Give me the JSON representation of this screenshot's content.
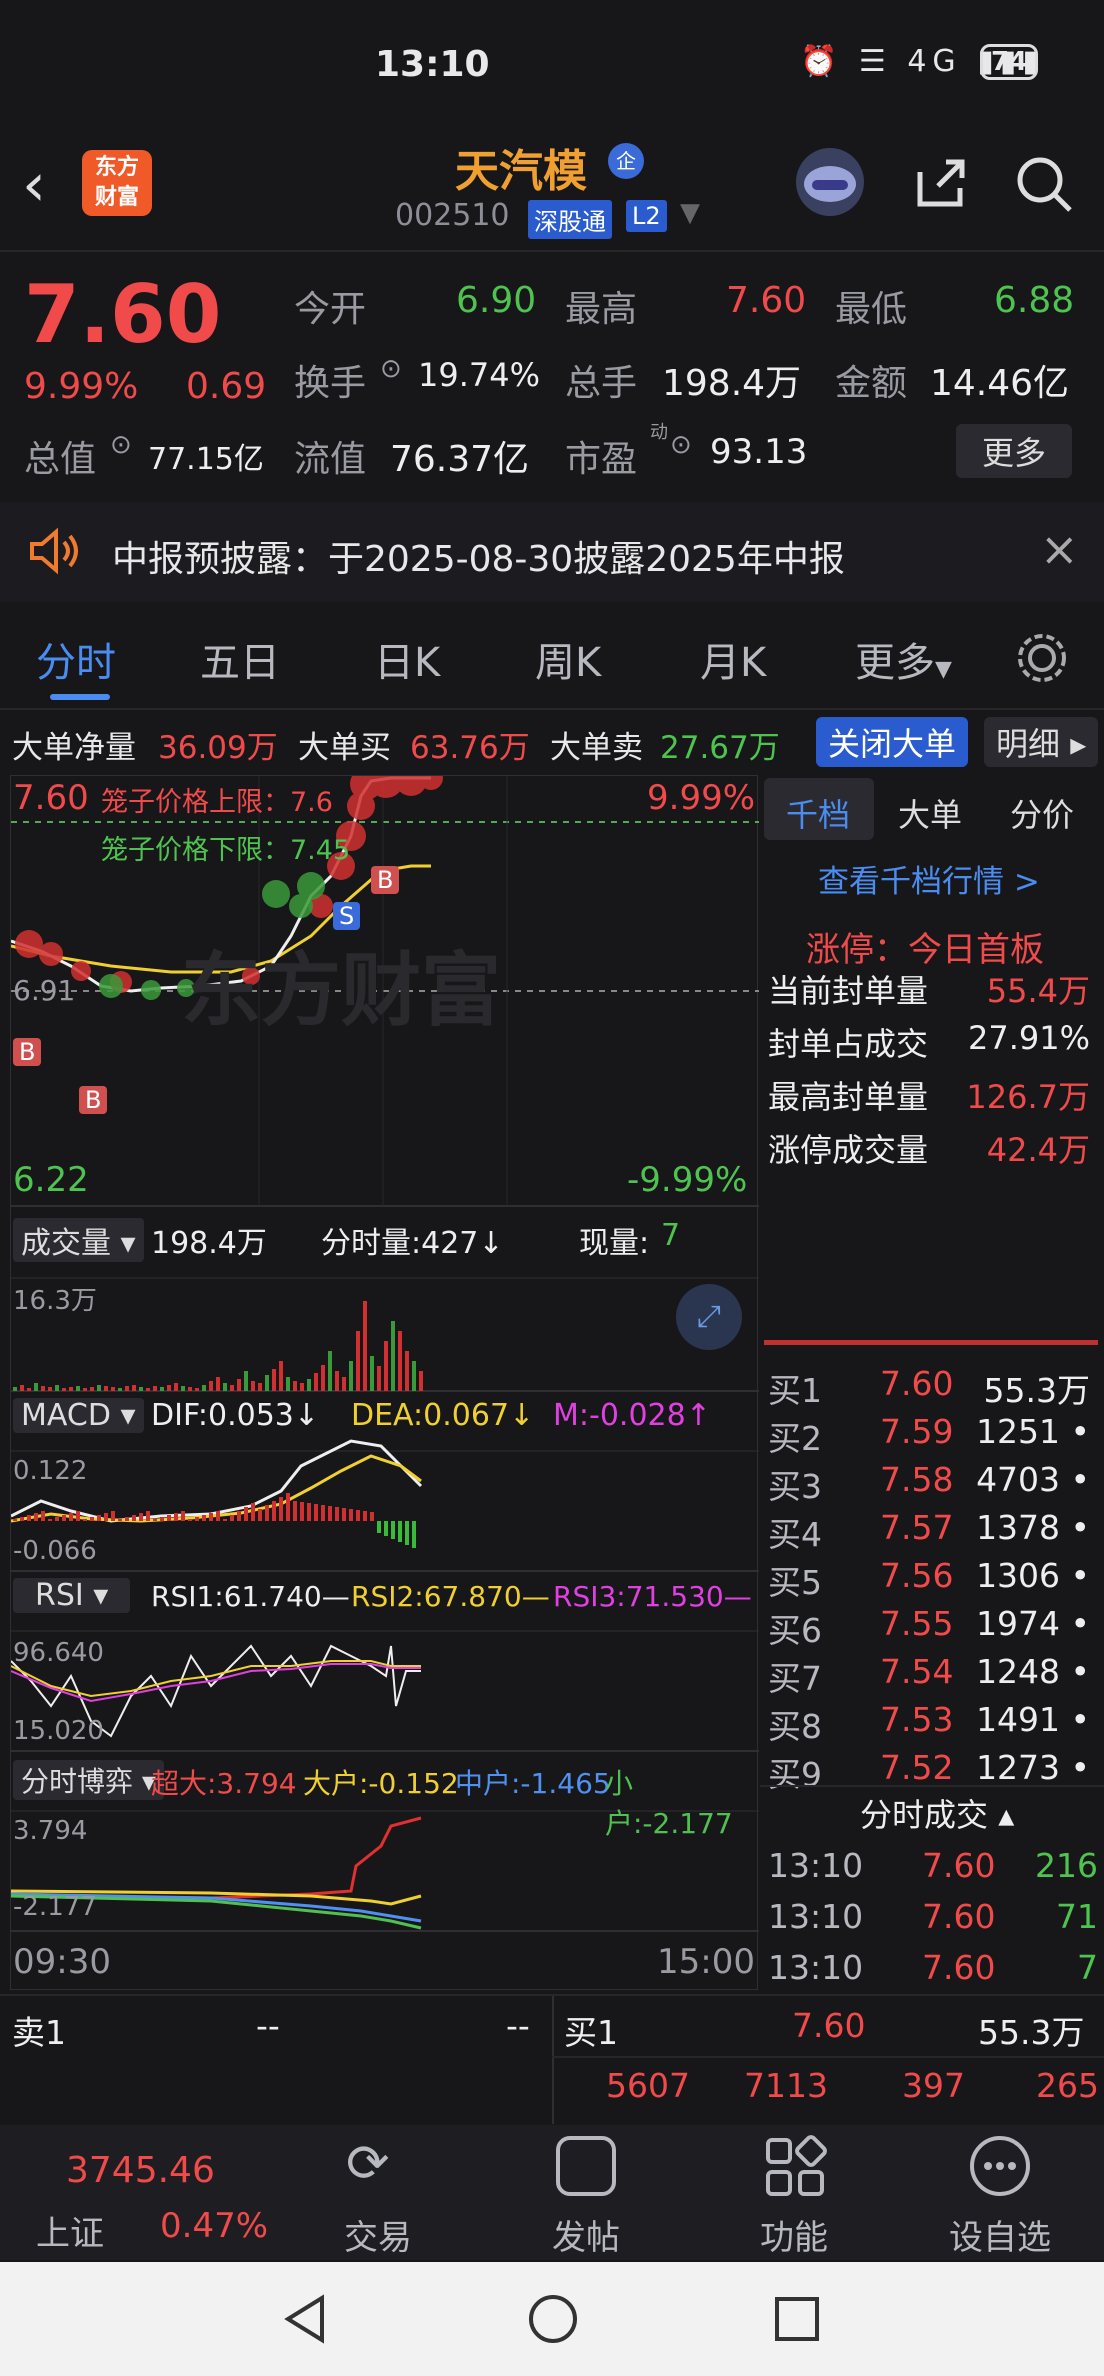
{
  "status": {
    "time": "13:10",
    "network": "4G",
    "battery": "74"
  },
  "header": {
    "logo_line1": "东方",
    "logo_line2": "财富",
    "stock_name": "天汽模",
    "badge": "企",
    "code": "002510",
    "tag1": "深股通",
    "tag2": "L2"
  },
  "quote": {
    "price": "7.60",
    "change_pct": "9.99%",
    "change": "0.69",
    "open_label": "今开",
    "open": "6.90",
    "high_label": "最高",
    "high": "7.60",
    "low_label": "最低",
    "low": "6.88",
    "turnover_label": "换手",
    "turnover": "19.74%",
    "volume_label": "总手",
    "volume": "198.4万",
    "amount_label": "金额",
    "amount": "14.46亿",
    "mktcap_label": "总值",
    "mktcap": "77.15亿",
    "float_label": "流值",
    "float": "76.37亿",
    "pe_label": "市盈",
    "pe_sup": "动",
    "pe": "93.13",
    "more": "更多"
  },
  "notice": {
    "text": "中报预披露：于2025-08-30披露2025年中报"
  },
  "tabs": [
    "分时",
    "五日",
    "日K",
    "周K",
    "月K",
    "更多"
  ],
  "bigorder": {
    "net_label": "大单净量",
    "net": "36.09万",
    "buy_label": "大单买",
    "buy": "63.76万",
    "sell_label": "大单卖",
    "sell": "27.67万",
    "close_btn": "关闭大单",
    "detail_btn": "明细"
  },
  "chart": {
    "top_price": "7.60",
    "top_pct": "9.99%",
    "cage_upper": "笼子价格上限：7.6",
    "cage_lower": "笼子价格下限：7.45",
    "mid_price": "6.91",
    "bottom_price": "6.22",
    "bottom_pct": "-9.99%",
    "watermark": "东方财富",
    "vol_label": "成交量",
    "vol_total": "198.4万",
    "min_vol": "分时量:427↓",
    "cur_vol_label": "现量:",
    "cur_vol": "7",
    "vol_max": "16.3万",
    "macd_label": "MACD",
    "dif": "DIF:0.053↓",
    "dea": "DEA:0.067↓",
    "m": "M:-0.028↑",
    "macd_top": "0.122",
    "macd_bottom": "-0.066",
    "rsi_label": "RSI",
    "rsi1": "RSI1:61.740—",
    "rsi2": "RSI2:67.870—",
    "rsi3": "RSI3:71.530—",
    "rsi_top": "96.640",
    "rsi_bottom": "15.020",
    "game_label": "分时博弈",
    "super": "超大:3.794",
    "big": "大户:-0.152",
    "mid": "中户:-1.465",
    "small": "小户:-2.177",
    "game_top": "3.794",
    "game_bottom": "-2.177",
    "time_start": "09:30",
    "time_end": "15:00",
    "marker_b": "B",
    "marker_s": "S"
  },
  "right_panel": {
    "tabs": [
      "千档",
      "大单",
      "分价"
    ],
    "link": "查看千档行情 >",
    "limit_up": "涨停：今日首板",
    "stats": [
      {
        "label": "当前封单量",
        "value": "55.4万"
      },
      {
        "label": "封单占成交",
        "value": "27.91%"
      },
      {
        "label": "最高封单量",
        "value": "126.7万"
      },
      {
        "label": "涨停成交量",
        "value": "42.4万"
      }
    ],
    "bids": [
      {
        "label": "买1",
        "price": "7.60",
        "vol": "55.3万"
      },
      {
        "label": "买2",
        "price": "7.59",
        "vol": "1251"
      },
      {
        "label": "买3",
        "price": "7.58",
        "vol": "4703"
      },
      {
        "label": "买4",
        "price": "7.57",
        "vol": "1378"
      },
      {
        "label": "买5",
        "price": "7.56",
        "vol": "1306"
      },
      {
        "label": "买6",
        "price": "7.55",
        "vol": "1974"
      },
      {
        "label": "买7",
        "price": "7.54",
        "vol": "1248"
      },
      {
        "label": "买8",
        "price": "7.53",
        "vol": "1491"
      },
      {
        "label": "买9",
        "price": "7.52",
        "vol": "1273"
      }
    ],
    "ticks_label": "分时成交",
    "ticks": [
      {
        "time": "13:10",
        "price": "7.60",
        "vol": "216"
      },
      {
        "time": "13:10",
        "price": "7.60",
        "vol": "71"
      },
      {
        "time": "13:10",
        "price": "7.60",
        "vol": "7"
      }
    ]
  },
  "bottom_quote": {
    "sell_label": "卖1",
    "sell_price": "--",
    "sell_vol": "--",
    "buy_label": "买1",
    "buy_price": "7.60",
    "buy_vol": "55.3万",
    "row2": [
      "5607",
      "7113",
      "397",
      "265"
    ]
  },
  "nav": {
    "index_value": "3745.46",
    "index_name": "上证",
    "index_pct": "0.47%",
    "items": [
      "交易",
      "发帖",
      "功能",
      "设自选"
    ]
  },
  "colors": {
    "up": "#f04a4a",
    "down": "#4fc34f",
    "accent": "#4a8cf0",
    "brand": "#f05a28",
    "yellow": "#f0d030",
    "magenta": "#e040e0"
  }
}
